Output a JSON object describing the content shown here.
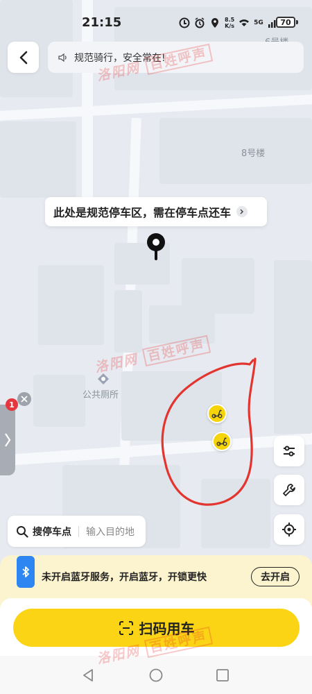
{
  "status_bar": {
    "time": "21:15",
    "net_speed": "8.5",
    "net_unit": "K/s",
    "network": "5G",
    "battery": "70"
  },
  "top_bar": {
    "notice": "规范骑行，安全常在!"
  },
  "map": {
    "labels": {
      "building_top": "6号楼",
      "building_8": "8号楼",
      "poi_toilet": "公共厕所"
    },
    "parking_tip": "此处是规范停车区，需在停车点还车",
    "colors": {
      "annotation": "#e3352f",
      "scooter": "#f6d40a"
    }
  },
  "side_panel": {
    "badge_count": "1"
  },
  "search": {
    "label": "搜停车点",
    "placeholder": "输入目的地"
  },
  "bluetooth_banner": {
    "text": "未开启蓝牙服务，开启蓝牙，开锁更快",
    "action": "去开启"
  },
  "primary_action": {
    "label": "扫码用车",
    "color": "#fbd515"
  },
  "watermark": {
    "site": "洛阳网",
    "tag": "百姓呼声"
  },
  "icons": [
    "back-arrow-icon",
    "speaker-icon",
    "location-pin-icon",
    "scooter-icon",
    "filter-icon",
    "wrench-icon",
    "locate-icon",
    "search-icon",
    "bluetooth-icon",
    "scan-icon"
  ]
}
